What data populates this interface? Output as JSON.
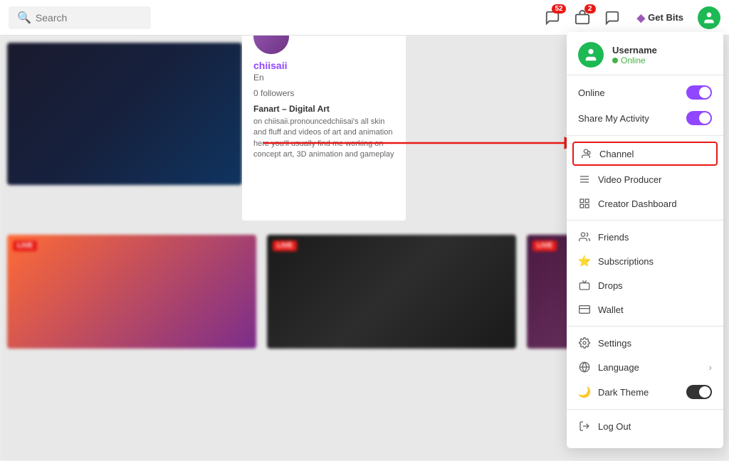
{
  "header": {
    "search_placeholder": "Search",
    "get_bits_label": "Get Bits"
  },
  "badges": {
    "notifications1": "52",
    "notifications2": "2"
  },
  "dropdown": {
    "username": "Username",
    "online_status": "Online",
    "online_label": "Online",
    "share_activity_label": "Share My Activity",
    "channel_label": "Channel",
    "video_producer_label": "Video Producer",
    "creator_dashboard_label": "Creator Dashboard",
    "friends_label": "Friends",
    "subscriptions_label": "Subscriptions",
    "drops_label": "Drops",
    "wallet_label": "Wallet",
    "settings_label": "Settings",
    "language_label": "Language",
    "dark_theme_label": "Dark Theme",
    "log_out_label": "Log Out"
  },
  "profile_card": {
    "name": "chiisaii",
    "status": "En",
    "followers": "0 followers",
    "game": "Fanart – Digital Art",
    "description": "on chiisaii.pronouncedchiisai's all skin and fluff and videos of art and animation here you'll usually find me working on concept art, 3D animation and gameplay"
  },
  "stream_cards": {
    "live_label": "LIVE"
  }
}
